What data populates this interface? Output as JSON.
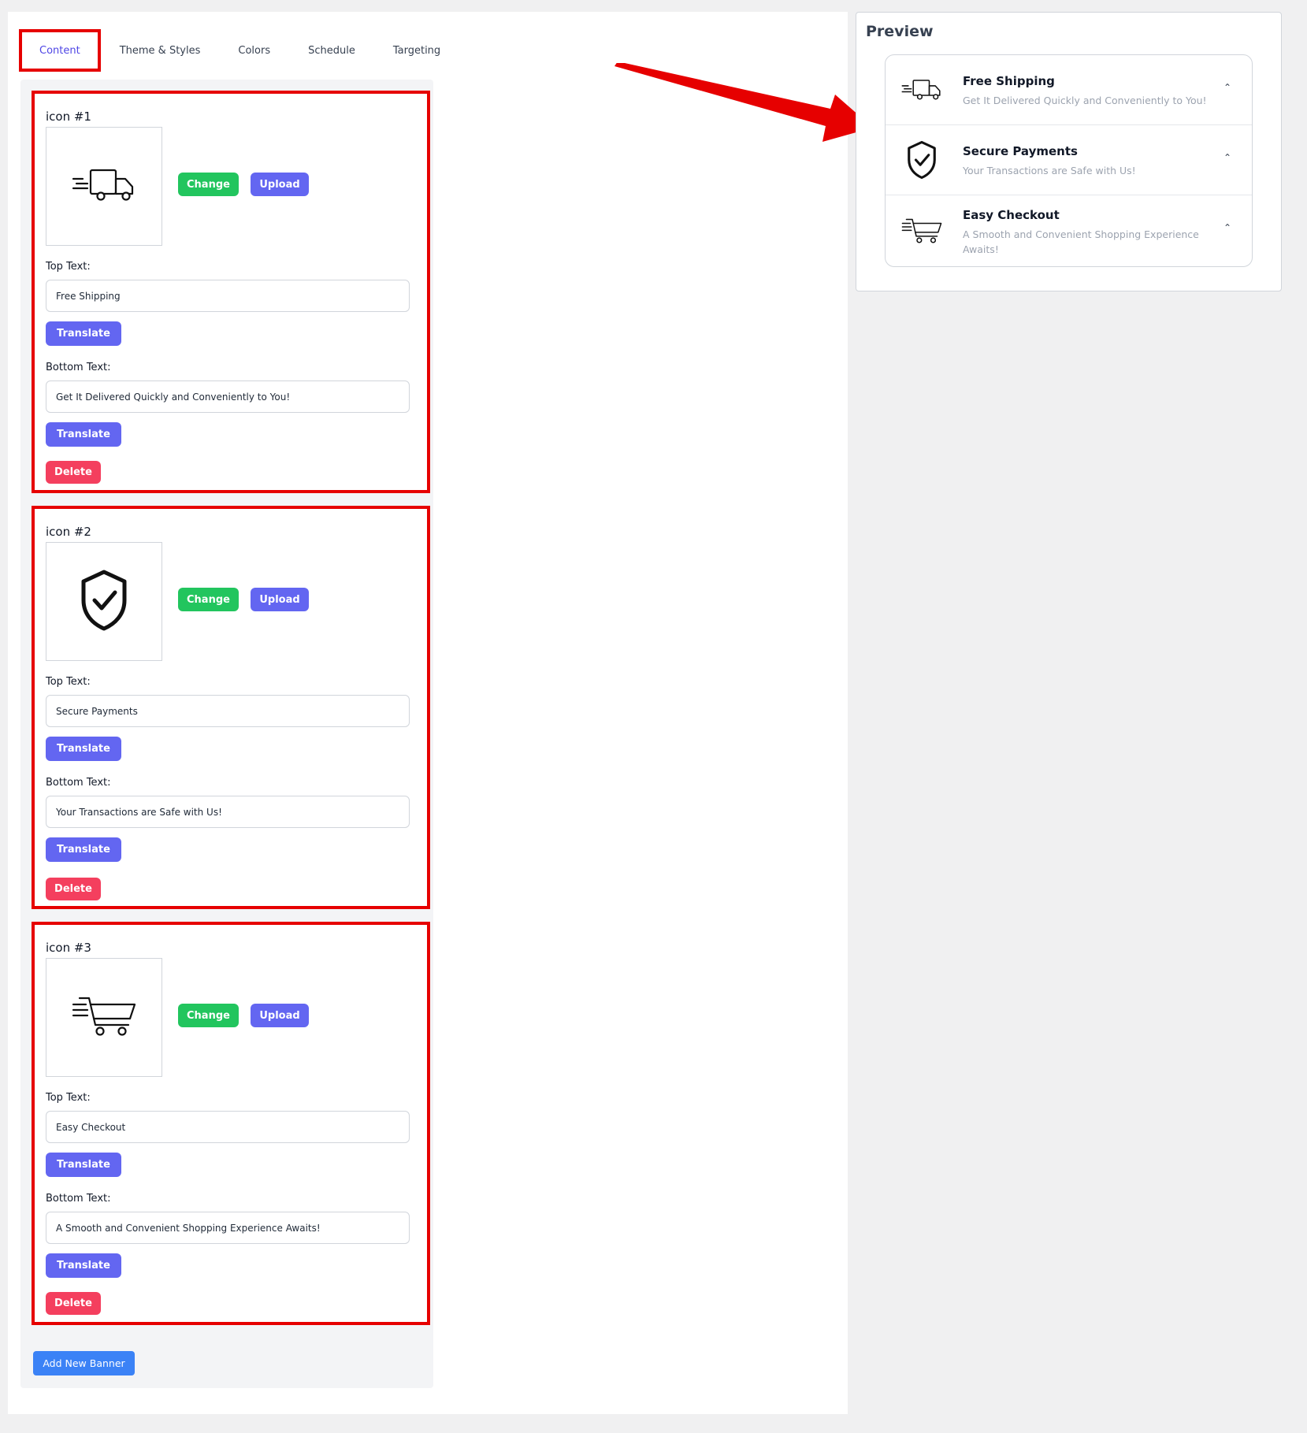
{
  "tabs": [
    {
      "label": "Content",
      "active": true
    },
    {
      "label": "Theme & Styles",
      "active": false
    },
    {
      "label": "Colors",
      "active": false
    },
    {
      "label": "Schedule",
      "active": false
    },
    {
      "label": "Targeting",
      "active": false
    }
  ],
  "cards": [
    {
      "label": "icon #1",
      "icon": "delivery-truck-icon",
      "change_label": "Change",
      "upload_label": "Upload",
      "top_text_label": "Top Text:",
      "top_text": "Free Shipping",
      "translate_label": "Translate",
      "bottom_text_label": "Bottom Text:",
      "bottom_text": "Get It Delivered Quickly and Conveniently to You!",
      "delete_label": "Delete"
    },
    {
      "label": "icon #2",
      "icon": "shield-check-icon",
      "change_label": "Change",
      "upload_label": "Upload",
      "top_text_label": "Top Text:",
      "top_text": "Secure Payments",
      "translate_label": "Translate",
      "bottom_text_label": "Bottom Text:",
      "bottom_text": "Your Transactions are Safe with Us!",
      "delete_label": "Delete"
    },
    {
      "label": "icon #3",
      "icon": "shopping-cart-icon",
      "change_label": "Change",
      "upload_label": "Upload",
      "top_text_label": "Top Text:",
      "top_text": "Easy Checkout",
      "translate_label": "Translate",
      "bottom_text_label": "Bottom Text:",
      "bottom_text": "A Smooth and Convenient Shopping Experience Awaits!",
      "delete_label": "Delete"
    }
  ],
  "add_button": "Add New Banner",
  "preview": {
    "title": "Preview",
    "items": [
      {
        "icon": "delivery-truck-icon",
        "title": "Free Shipping",
        "subtitle": "Get It Delivered Quickly and Conveniently to You!",
        "chevron": "⌃"
      },
      {
        "icon": "shield-check-icon",
        "title": "Secure Payments",
        "subtitle": "Your Transactions are Safe with Us!",
        "chevron": "⌃"
      },
      {
        "icon": "shopping-cart-icon",
        "title": "Easy Checkout",
        "subtitle": "A Smooth and Convenient Shopping Experience Awaits!",
        "chevron": "⌃"
      }
    ]
  },
  "colors": {
    "highlight": "#e60000",
    "change": "#22c55e",
    "upload": "#6366f1",
    "translate": "#6366f1",
    "delete": "#f43f5e",
    "add": "#3b82f6",
    "active_tab": "#4f46e5"
  }
}
